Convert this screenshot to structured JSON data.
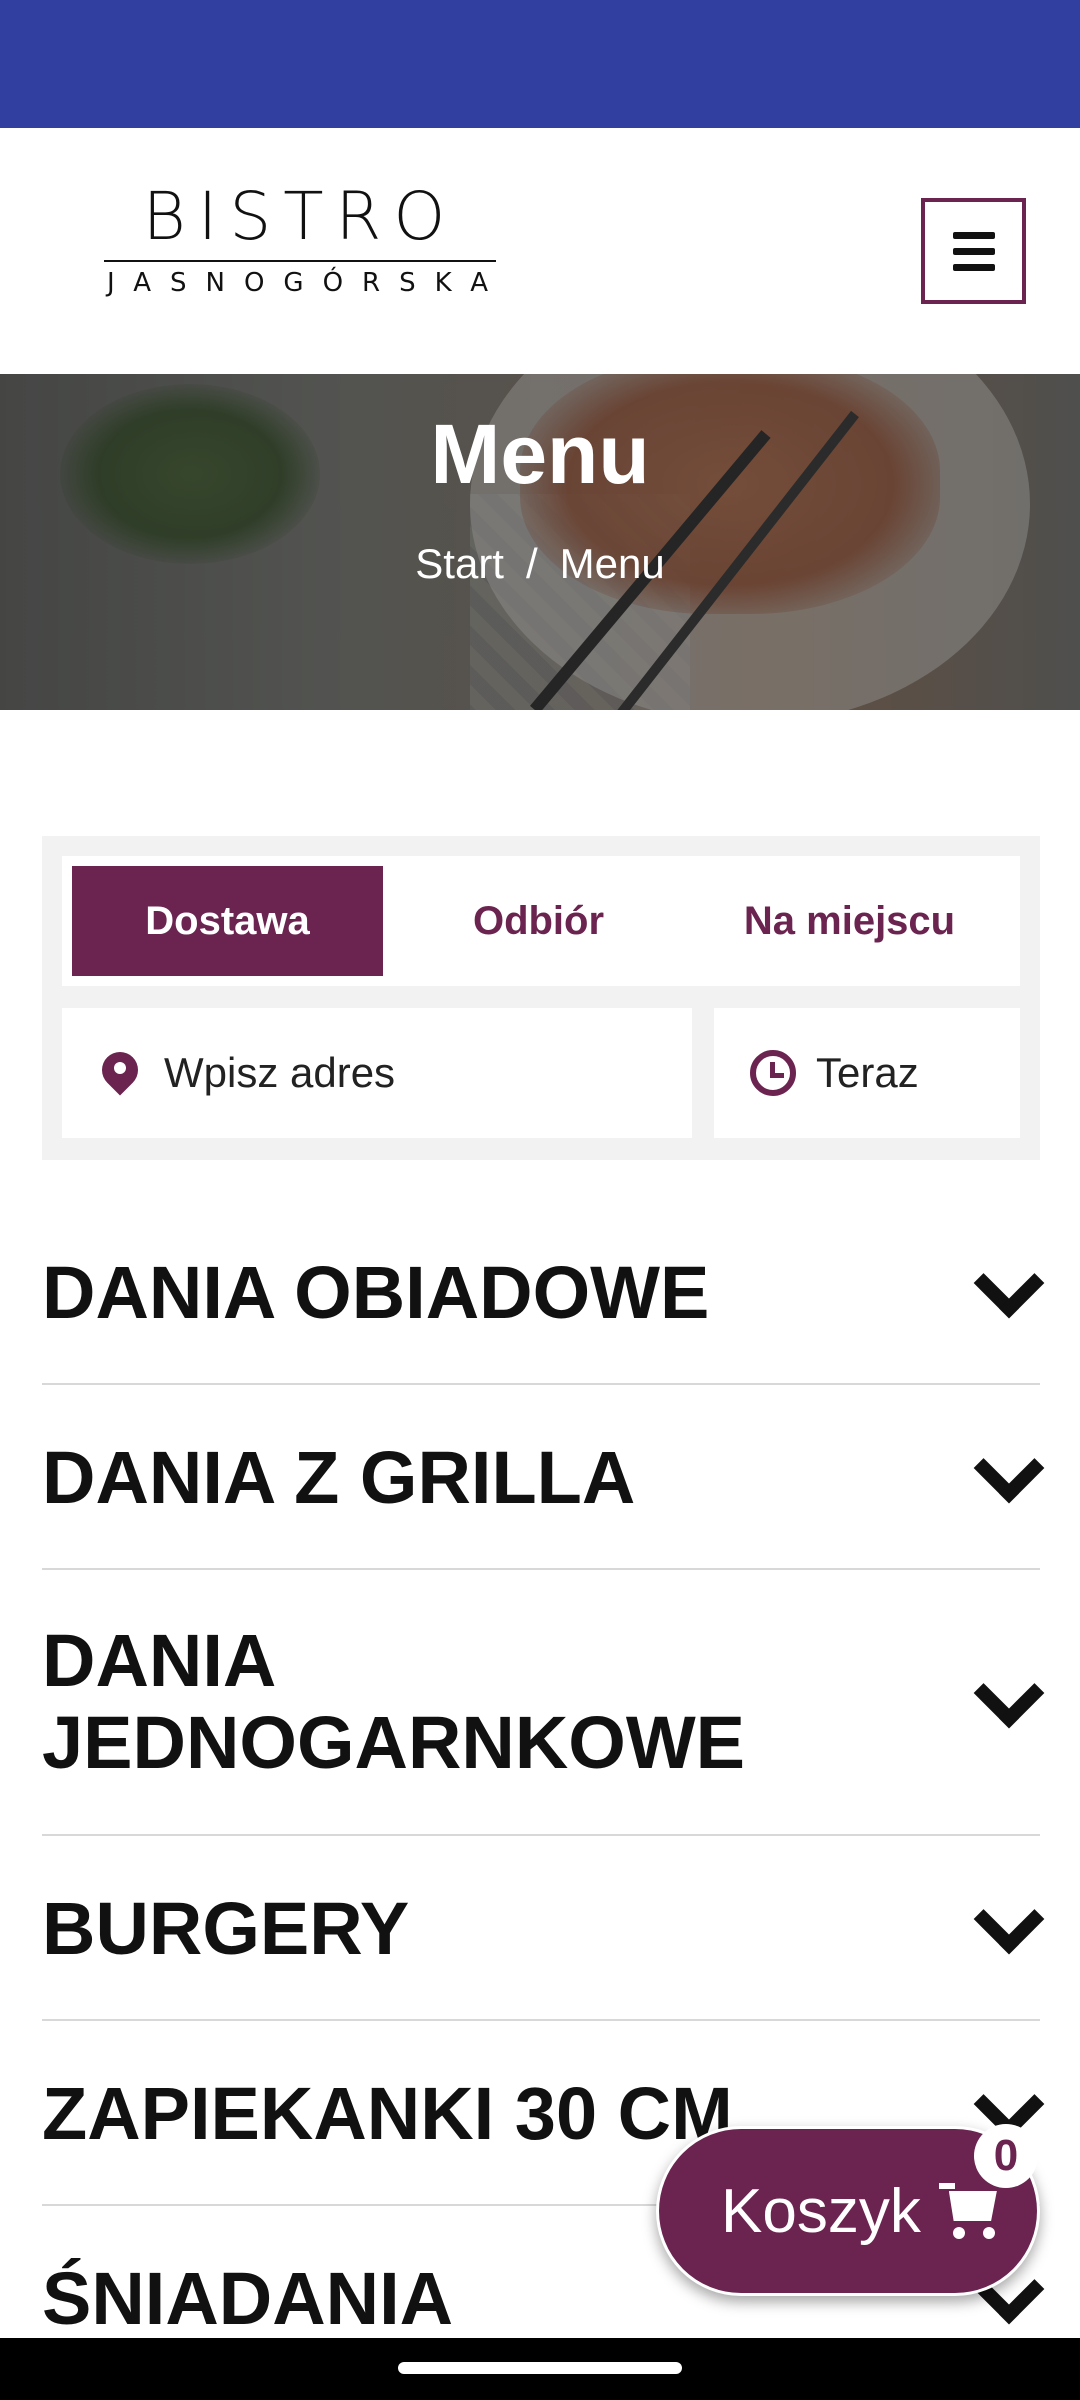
{
  "logo": {
    "top": "BISTRO",
    "bottom": "JASNOGÓRSKA"
  },
  "hero": {
    "title": "Menu",
    "breadcrumb": [
      "Start",
      "/",
      "Menu"
    ]
  },
  "order": {
    "tabs": [
      {
        "label": "Dostawa",
        "active": true
      },
      {
        "label": "Odbiór",
        "active": false
      },
      {
        "label": "Na miejscu",
        "active": false
      }
    ],
    "address_placeholder": "Wpisz adres",
    "time_value": "Teraz"
  },
  "categories": [
    "DANIA OBIADOWE",
    "DANIA Z GRILLA",
    "DANIA JEDNOGARNKOWE",
    "BURGERY",
    "ZAPIEKANKI 30 CM",
    "ŚNIADANIA"
  ],
  "cart": {
    "label": "Koszyk",
    "count": "0"
  },
  "colors": {
    "status_bar": "#313fa0",
    "accent": "#6b2450",
    "nav_bar": "#000000"
  },
  "icons": [
    "menu-icon",
    "map-pin-icon",
    "clock-icon",
    "chevron-down-icon",
    "cart-icon"
  ]
}
